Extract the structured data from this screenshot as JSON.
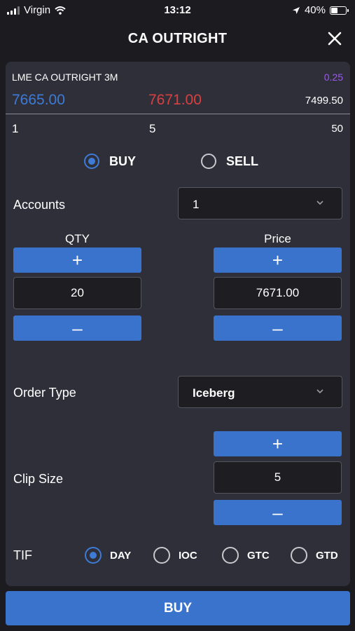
{
  "status_bar": {
    "carrier": "Virgin",
    "time": "13:12",
    "battery": "40%"
  },
  "header": {
    "title": "CA OUTRIGHT"
  },
  "instrument": {
    "name": "LME CA OUTRIGHT 3M",
    "change": "0.25",
    "bid": "7665.00",
    "ask": "7671.00",
    "last": "7499.50",
    "bid_size": "1",
    "ask_size": "5",
    "last_size": "50"
  },
  "side": {
    "buy": "BUY",
    "sell": "SELL",
    "selected": "BUY"
  },
  "accounts": {
    "label": "Accounts",
    "value": "1"
  },
  "qty": {
    "label": "QTY",
    "value": "20"
  },
  "price": {
    "label": "Price",
    "value": "7671.00"
  },
  "order_type": {
    "label": "Order Type",
    "value": "Iceberg"
  },
  "clip_size": {
    "label": "Clip Size",
    "value": "5"
  },
  "tif": {
    "label": "TIF",
    "options": [
      "DAY",
      "IOC",
      "GTC",
      "GTD"
    ],
    "selected": "DAY"
  },
  "buttons": {
    "plus": "+",
    "minus": "–",
    "submit": "BUY"
  },
  "colors": {
    "accent": "#3a73cc",
    "bid": "#3d7bd6",
    "ask": "#d84040",
    "change": "#9b59e8",
    "panel": "#2f2f3a"
  },
  "icons": [
    "signal-icon",
    "wifi-icon",
    "location-icon",
    "battery-icon",
    "close-icon",
    "chevron-down-icon"
  ]
}
